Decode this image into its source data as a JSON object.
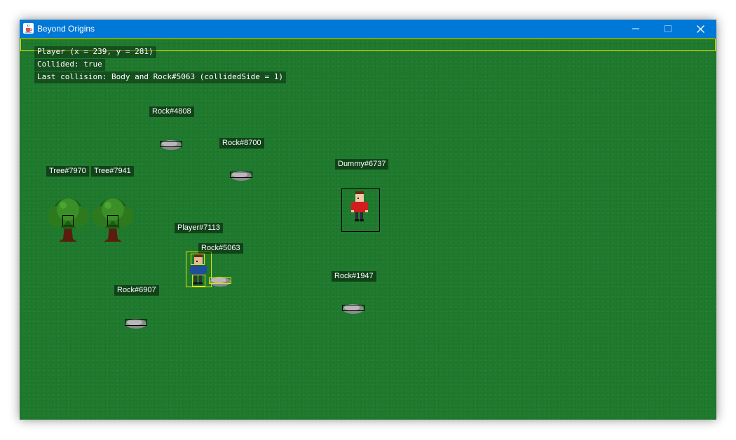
{
  "window": {
    "title": "Beyond Origins",
    "icon": "java-cup-icon",
    "controls": [
      "minimize-icon",
      "maximize-icon",
      "close-icon"
    ],
    "titlebar_color": "#0078d7"
  },
  "debug": {
    "player_line": "Player (x = 239, y = 281)",
    "collided_line": "Collided: true",
    "last_collision_line": "Last collision: Body and Rock#5063 (collidedSide = 1)"
  },
  "entities": {
    "rock_4808": "Rock#4808",
    "rock_8700": "Rock#8700",
    "tree_7970": "Tree#7970",
    "tree_7941": "Tree#7941",
    "dummy_6737": "Dummy#6737",
    "player_7113": "Player#7113",
    "rock_5063": "Rock#5063",
    "rock_6907": "Rock#6907",
    "rock_1947": "Rock#1947"
  },
  "colors": {
    "grass": "#1f7a2e",
    "highlight": "#e6e600",
    "hitbox": "#000000"
  }
}
